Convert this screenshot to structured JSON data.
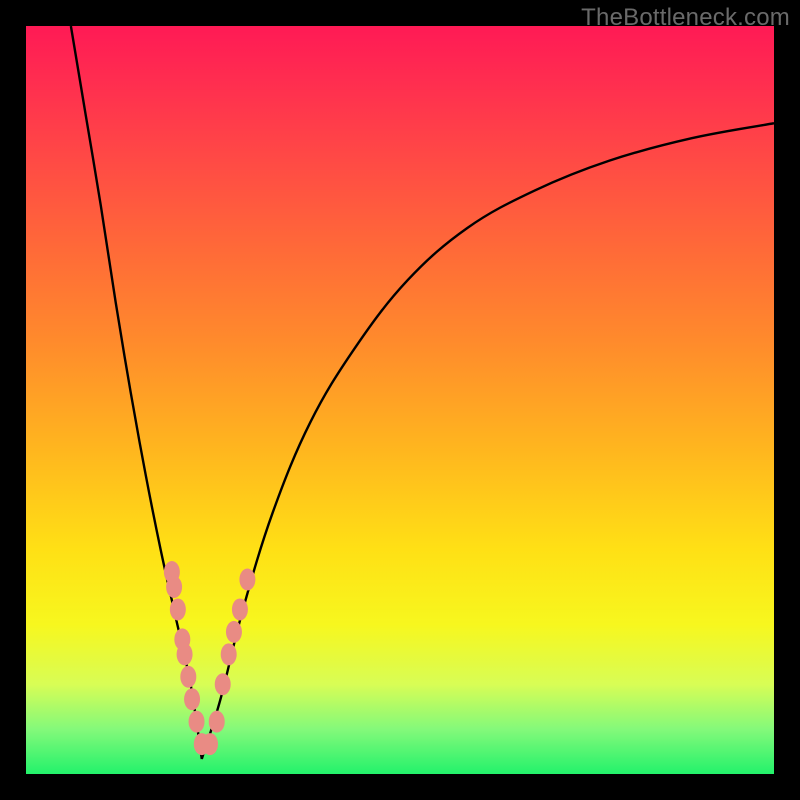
{
  "watermark": "TheBottleneck.com",
  "chart_data": {
    "type": "line",
    "title": "",
    "xlabel": "",
    "ylabel": "",
    "xlim": [
      0,
      100
    ],
    "ylim": [
      0,
      100
    ],
    "legend": false,
    "grid": false,
    "background_gradient": {
      "top": "#ff1a55",
      "mid": "#ffd818",
      "bottom": "#23f26b"
    },
    "series": [
      {
        "name": "bottleneck-curve-left",
        "stroke": "#000000",
        "x": [
          6,
          8,
          10,
          12,
          14,
          16,
          18,
          20,
          22,
          23.5
        ],
        "y": [
          100,
          88,
          76,
          63,
          51,
          40,
          30,
          21,
          12,
          2
        ]
      },
      {
        "name": "bottleneck-curve-right",
        "stroke": "#000000",
        "x": [
          23.5,
          26,
          29,
          33,
          38,
          44,
          51,
          59,
          68,
          78,
          89,
          100
        ],
        "y": [
          2,
          10,
          22,
          35,
          47,
          57,
          66,
          73,
          78,
          82,
          85,
          87
        ]
      }
    ],
    "annotations": [
      {
        "name": "highlight-dots",
        "color": "#e98b84",
        "points": [
          {
            "x": 19.5,
            "y": 27
          },
          {
            "x": 19.8,
            "y": 25
          },
          {
            "x": 20.3,
            "y": 22
          },
          {
            "x": 20.9,
            "y": 18
          },
          {
            "x": 21.2,
            "y": 16
          },
          {
            "x": 21.7,
            "y": 13
          },
          {
            "x": 22.2,
            "y": 10
          },
          {
            "x": 22.8,
            "y": 7
          },
          {
            "x": 23.5,
            "y": 4
          },
          {
            "x": 24.6,
            "y": 4
          },
          {
            "x": 25.5,
            "y": 7
          },
          {
            "x": 26.3,
            "y": 12
          },
          {
            "x": 27.1,
            "y": 16
          },
          {
            "x": 27.8,
            "y": 19
          },
          {
            "x": 28.6,
            "y": 22
          },
          {
            "x": 29.6,
            "y": 26
          }
        ]
      }
    ]
  }
}
